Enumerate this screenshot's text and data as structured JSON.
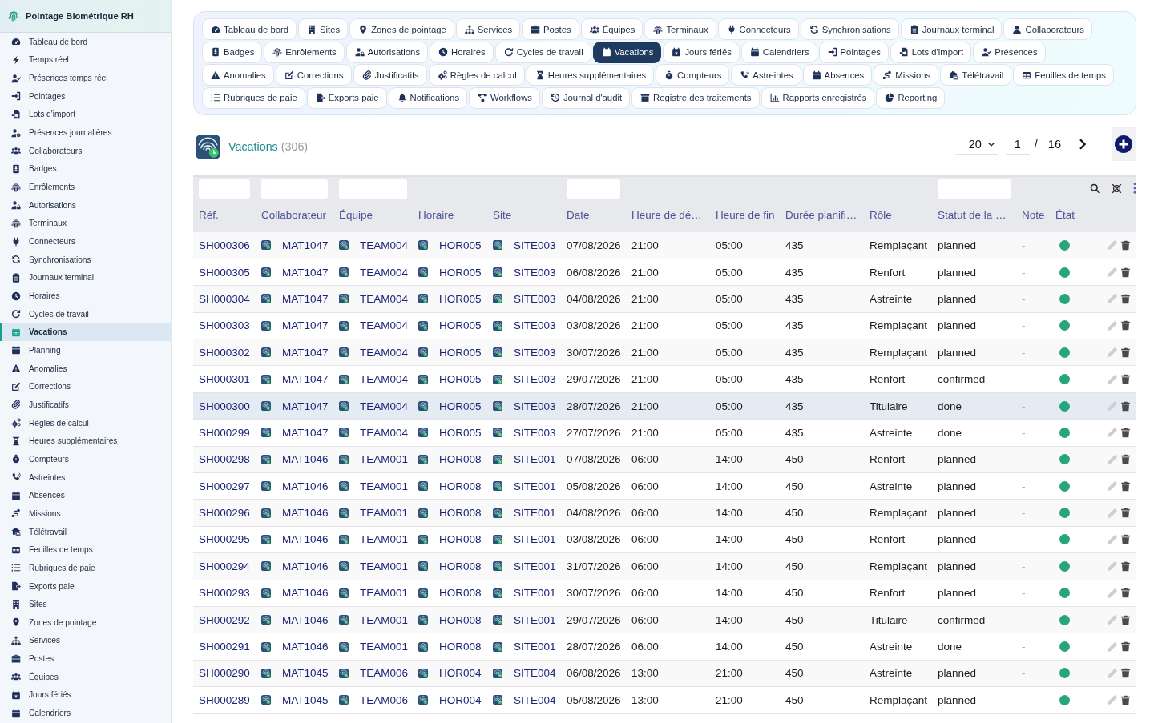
{
  "sidebar": {
    "title": "Pointage Biométrique RH",
    "items": [
      {
        "label": "Tableau de bord",
        "selected": false
      },
      {
        "label": "Temps réel",
        "selected": false
      },
      {
        "label": "Présences temps réel",
        "selected": false
      },
      {
        "label": "Pointages",
        "selected": false
      },
      {
        "label": "Lots d'import",
        "selected": false
      },
      {
        "label": "Présences journalières",
        "selected": false
      },
      {
        "label": "Collaborateurs",
        "selected": false
      },
      {
        "label": "Badges",
        "selected": false
      },
      {
        "label": "Enrôlements",
        "selected": false
      },
      {
        "label": "Autorisations",
        "selected": false
      },
      {
        "label": "Terminaux",
        "selected": false
      },
      {
        "label": "Connecteurs",
        "selected": false
      },
      {
        "label": "Synchronisations",
        "selected": false
      },
      {
        "label": "Journaux terminal",
        "selected": false
      },
      {
        "label": "Horaires",
        "selected": false
      },
      {
        "label": "Cycles de travail",
        "selected": false
      },
      {
        "label": "Vacations",
        "selected": true
      },
      {
        "label": "Planning",
        "selected": false
      },
      {
        "label": "Anomalies",
        "selected": false
      },
      {
        "label": "Corrections",
        "selected": false
      },
      {
        "label": "Justificatifs",
        "selected": false
      },
      {
        "label": "Règles de calcul",
        "selected": false
      },
      {
        "label": "Heures supplémentaires",
        "selected": false
      },
      {
        "label": "Compteurs",
        "selected": false
      },
      {
        "label": "Astreintes",
        "selected": false
      },
      {
        "label": "Absences",
        "selected": false
      },
      {
        "label": "Missions",
        "selected": false
      },
      {
        "label": "Télétravail",
        "selected": false
      },
      {
        "label": "Feuilles de temps",
        "selected": false
      },
      {
        "label": "Rubriques de paie",
        "selected": false
      },
      {
        "label": "Exports paie",
        "selected": false
      },
      {
        "label": "Sites",
        "selected": false
      },
      {
        "label": "Zones de pointage",
        "selected": false
      },
      {
        "label": "Services",
        "selected": false
      },
      {
        "label": "Postes",
        "selected": false
      },
      {
        "label": "Équipes",
        "selected": false
      },
      {
        "label": "Jours fériés",
        "selected": false
      },
      {
        "label": "Calendriers",
        "selected": false
      }
    ]
  },
  "tab_rows": [
    {
      "tabs": [
        {
          "label": "Tableau de bord",
          "selected": false
        },
        {
          "label": "Sites",
          "selected": false
        },
        {
          "label": "Zones de pointage",
          "selected": false
        },
        {
          "label": "Services",
          "selected": false
        },
        {
          "label": "Postes",
          "selected": false
        },
        {
          "label": "Équipes",
          "selected": false
        },
        {
          "label": "Terminaux",
          "selected": false
        },
        {
          "label": "Connecteurs",
          "selected": false
        },
        {
          "label": "Synchronisations",
          "selected": false
        },
        {
          "label": "Journaux terminal",
          "selected": false
        },
        {
          "label": "Collaborateurs",
          "selected": false
        }
      ]
    },
    {
      "tabs": [
        {
          "label": "Badges",
          "selected": false
        },
        {
          "label": "Enrôlements",
          "selected": false
        },
        {
          "label": "Autorisations",
          "selected": false
        },
        {
          "label": "Horaires",
          "selected": false
        },
        {
          "label": "Cycles de travail",
          "selected": false
        },
        {
          "label": "Vacations",
          "selected": true
        },
        {
          "label": "Jours fériés",
          "selected": false
        },
        {
          "label": "Calendriers",
          "selected": false
        },
        {
          "label": "Pointages",
          "selected": false
        },
        {
          "label": "Lots d'import",
          "selected": false
        },
        {
          "label": "Présences",
          "selected": false
        }
      ]
    },
    {
      "tabs": [
        {
          "label": "Anomalies",
          "selected": false
        },
        {
          "label": "Corrections",
          "selected": false
        },
        {
          "label": "Justificatifs",
          "selected": false
        },
        {
          "label": "Règles de calcul",
          "selected": false
        },
        {
          "label": "Heures supplémentaires",
          "selected": false
        },
        {
          "label": "Compteurs",
          "selected": false
        },
        {
          "label": "Astreintes",
          "selected": false
        },
        {
          "label": "Absences",
          "selected": false
        },
        {
          "label": "Missions",
          "selected": false
        },
        {
          "label": "Télétravail",
          "selected": false
        },
        {
          "label": "Feuilles de temps",
          "selected": false
        }
      ]
    },
    {
      "tabs": [
        {
          "label": "Rubriques de paie",
          "selected": false
        },
        {
          "label": "Exports paie",
          "selected": false
        },
        {
          "label": "Notifications",
          "selected": false
        },
        {
          "label": "Workflows",
          "selected": false
        },
        {
          "label": "Journal d'audit",
          "selected": false
        },
        {
          "label": "Registre des traitements",
          "selected": false
        },
        {
          "label": "Rapports enregistrés",
          "selected": false
        },
        {
          "label": "Reporting",
          "selected": false
        }
      ]
    }
  ],
  "header": {
    "title": "Vacations",
    "count": "(306)"
  },
  "pagination": {
    "page_size": "20",
    "page": "1",
    "separator": "/",
    "total_pages": "16"
  },
  "table": {
    "columns": [
      {
        "label": "Réf.",
        "kind": "link",
        "filter": true
      },
      {
        "label": "Collaborateur",
        "kind": "entity",
        "filter": true
      },
      {
        "label": "Équipe",
        "kind": "entity",
        "filter": true
      },
      {
        "label": "Horaire",
        "kind": "entity",
        "filter": false
      },
      {
        "label": "Site",
        "kind": "entity",
        "filter": false
      },
      {
        "label": "Date",
        "kind": "text",
        "filter": true
      },
      {
        "label": "Heure de dé…",
        "kind": "text",
        "filter": false
      },
      {
        "label": "Heure de fin",
        "kind": "text",
        "filter": false
      },
      {
        "label": "Durée planifi…",
        "kind": "text",
        "filter": false
      },
      {
        "label": "Rôle",
        "kind": "text",
        "filter": false
      },
      {
        "label": "Statut de la …",
        "kind": "text",
        "filter": true
      },
      {
        "label": "Note",
        "kind": "muted",
        "filter": false
      },
      {
        "label": "État",
        "kind": "status",
        "filter": false
      }
    ],
    "rows": [
      {
        "cells": [
          "SH000306",
          "MAT1047",
          "TEAM004",
          "HOR005",
          "SITE003",
          "07/08/2026",
          "21:00",
          "05:00",
          "435",
          "Remplaçant",
          "planned",
          "-"
        ],
        "active": true,
        "selected": false
      },
      {
        "cells": [
          "SH000305",
          "MAT1047",
          "TEAM004",
          "HOR005",
          "SITE003",
          "06/08/2026",
          "21:00",
          "05:00",
          "435",
          "Renfort",
          "planned",
          "-"
        ],
        "active": true,
        "selected": false
      },
      {
        "cells": [
          "SH000304",
          "MAT1047",
          "TEAM004",
          "HOR005",
          "SITE003",
          "04/08/2026",
          "21:00",
          "05:00",
          "435",
          "Astreinte",
          "planned",
          "-"
        ],
        "active": true,
        "selected": false
      },
      {
        "cells": [
          "SH000303",
          "MAT1047",
          "TEAM004",
          "HOR005",
          "SITE003",
          "03/08/2026",
          "21:00",
          "05:00",
          "435",
          "Remplaçant",
          "planned",
          "-"
        ],
        "active": true,
        "selected": false
      },
      {
        "cells": [
          "SH000302",
          "MAT1047",
          "TEAM004",
          "HOR005",
          "SITE003",
          "30/07/2026",
          "21:00",
          "05:00",
          "435",
          "Remplaçant",
          "planned",
          "-"
        ],
        "active": true,
        "selected": false
      },
      {
        "cells": [
          "SH000301",
          "MAT1047",
          "TEAM004",
          "HOR005",
          "SITE003",
          "29/07/2026",
          "21:00",
          "05:00",
          "435",
          "Renfort",
          "confirmed",
          "-"
        ],
        "active": true,
        "selected": false
      },
      {
        "cells": [
          "SH000300",
          "MAT1047",
          "TEAM004",
          "HOR005",
          "SITE003",
          "28/07/2026",
          "21:00",
          "05:00",
          "435",
          "Titulaire",
          "done",
          "-"
        ],
        "active": true,
        "selected": true
      },
      {
        "cells": [
          "SH000299",
          "MAT1047",
          "TEAM004",
          "HOR005",
          "SITE003",
          "27/07/2026",
          "21:00",
          "05:00",
          "435",
          "Astreinte",
          "done",
          "-"
        ],
        "active": true,
        "selected": false
      },
      {
        "cells": [
          "SH000298",
          "MAT1046",
          "TEAM001",
          "HOR008",
          "SITE001",
          "07/08/2026",
          "06:00",
          "14:00",
          "450",
          "Renfort",
          "planned",
          "-"
        ],
        "active": true,
        "selected": false
      },
      {
        "cells": [
          "SH000297",
          "MAT1046",
          "TEAM001",
          "HOR008",
          "SITE001",
          "05/08/2026",
          "06:00",
          "14:00",
          "450",
          "Astreinte",
          "planned",
          "-"
        ],
        "active": true,
        "selected": false
      },
      {
        "cells": [
          "SH000296",
          "MAT1046",
          "TEAM001",
          "HOR008",
          "SITE001",
          "04/08/2026",
          "06:00",
          "14:00",
          "450",
          "Remplaçant",
          "planned",
          "-"
        ],
        "active": true,
        "selected": false
      },
      {
        "cells": [
          "SH000295",
          "MAT1046",
          "TEAM001",
          "HOR008",
          "SITE001",
          "03/08/2026",
          "06:00",
          "14:00",
          "450",
          "Renfort",
          "planned",
          "-"
        ],
        "active": true,
        "selected": false
      },
      {
        "cells": [
          "SH000294",
          "MAT1046",
          "TEAM001",
          "HOR008",
          "SITE001",
          "31/07/2026",
          "06:00",
          "14:00",
          "450",
          "Remplaçant",
          "planned",
          "-"
        ],
        "active": true,
        "selected": false
      },
      {
        "cells": [
          "SH000293",
          "MAT1046",
          "TEAM001",
          "HOR008",
          "SITE001",
          "30/07/2026",
          "06:00",
          "14:00",
          "450",
          "Renfort",
          "planned",
          "-"
        ],
        "active": true,
        "selected": false
      },
      {
        "cells": [
          "SH000292",
          "MAT1046",
          "TEAM001",
          "HOR008",
          "SITE001",
          "29/07/2026",
          "06:00",
          "14:00",
          "450",
          "Titulaire",
          "confirmed",
          "-"
        ],
        "active": true,
        "selected": false
      },
      {
        "cells": [
          "SH000291",
          "MAT1046",
          "TEAM001",
          "HOR008",
          "SITE001",
          "28/07/2026",
          "06:00",
          "14:00",
          "450",
          "Astreinte",
          "done",
          "-"
        ],
        "active": true,
        "selected": false
      },
      {
        "cells": [
          "SH000290",
          "MAT1045",
          "TEAM006",
          "HOR004",
          "SITE004",
          "06/08/2026",
          "13:00",
          "21:00",
          "450",
          "Astreinte",
          "planned",
          "-"
        ],
        "active": true,
        "selected": false
      },
      {
        "cells": [
          "SH000289",
          "MAT1045",
          "TEAM006",
          "HOR004",
          "SITE004",
          "05/08/2026",
          "13:00",
          "21:00",
          "450",
          "Remplaçant",
          "planned",
          "-"
        ],
        "active": true,
        "selected": false
      }
    ]
  }
}
